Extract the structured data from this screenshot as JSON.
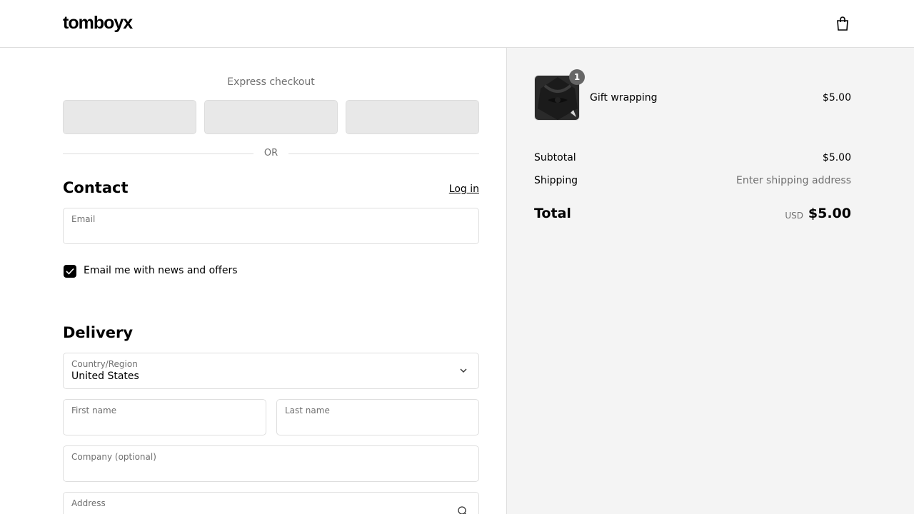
{
  "header": {
    "logo": "tomboyx",
    "cart_icon": "shopping-bag-icon"
  },
  "express": {
    "title": "Express checkout",
    "divider": "OR"
  },
  "contact": {
    "title": "Contact",
    "login_label": "Log in",
    "email_label": "Email",
    "email_value": "",
    "newsletter_label": "Email me with news and offers",
    "newsletter_checked": true
  },
  "delivery": {
    "title": "Delivery",
    "country_label": "Country/Region",
    "country_value": "United States",
    "first_name_label": "First name",
    "last_name_label": "Last name",
    "company_label": "Company (optional)",
    "address_label": "Address"
  },
  "summary": {
    "item": {
      "name": "Gift wrapping",
      "price": "$5.00",
      "quantity": "1"
    },
    "subtotal_label": "Subtotal",
    "subtotal_value": "$5.00",
    "shipping_label": "Shipping",
    "shipping_value": "Enter shipping address",
    "total_label": "Total",
    "currency": "USD",
    "total_value": "$5.00"
  },
  "colors": {
    "accent": "#000000",
    "summary_bg": "#f4f4f4",
    "muted_text": "#707070",
    "border": "#dedede"
  }
}
